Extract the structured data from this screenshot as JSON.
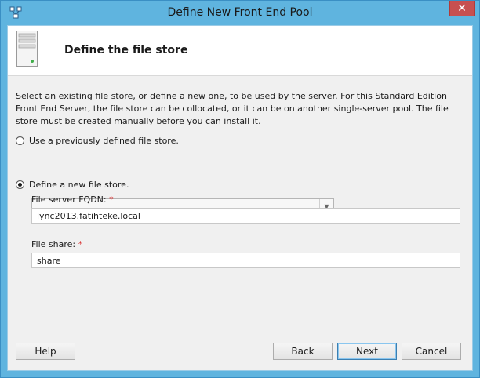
{
  "window": {
    "title": "Define New Front End Pool",
    "close_symbol": "✕",
    "app_icon": "pool-icon"
  },
  "header": {
    "icon": "server-icon",
    "heading": "Define the file store"
  },
  "description": "Select an existing file store, or define a new one, to be used by the server. For this Standard Edition Front End Server, the file store can be collocated, or it can be on another single-server pool. The file store must be created manually before you can install it.",
  "options": {
    "existing": {
      "label": "Use a previously defined file store.",
      "selected": false
    },
    "new": {
      "label": "Define a new file store.",
      "selected": true
    }
  },
  "existing_store_combo": {
    "value": "",
    "arrow": "▼"
  },
  "file_server": {
    "label": "File server FQDN:",
    "required_mark": "*",
    "value": "lync2013.fatihteke.local"
  },
  "file_share": {
    "label": "File share:",
    "required_mark": "*",
    "value": "share"
  },
  "buttons": {
    "help": "Help",
    "back": "Back",
    "next": "Next",
    "cancel": "Cancel"
  },
  "colors": {
    "titlebar": "#5fb4df",
    "close": "#c75050",
    "required": "#d93a3a",
    "body": "#f0f0f0"
  }
}
